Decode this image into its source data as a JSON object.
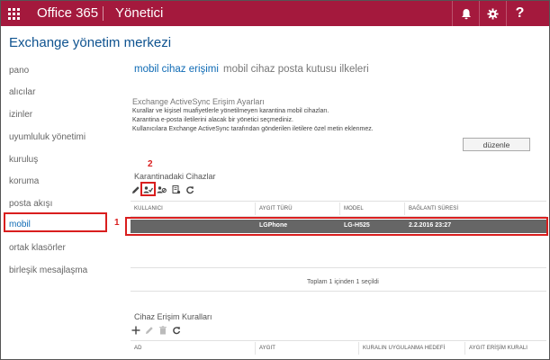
{
  "topbar": {
    "brand": "Office 365",
    "app": "Yönetici",
    "icons": [
      "waffle-icon",
      "bell-icon",
      "gear-icon",
      "help-icon"
    ],
    "help_glyph": "?",
    "color": "#a4193d"
  },
  "page": {
    "title": "Exchange yönetim merkezi"
  },
  "nav": {
    "items": [
      {
        "label": "pano"
      },
      {
        "label": "alıcılar"
      },
      {
        "label": "izinler"
      },
      {
        "label": "uyumluluk yönetimi"
      },
      {
        "label": "kuruluş"
      },
      {
        "label": "koruma"
      },
      {
        "label": "posta akışı"
      },
      {
        "label": "mobil"
      },
      {
        "label": "ortak klasörler"
      },
      {
        "label": "birleşik mesajlaşma"
      }
    ],
    "active": "mobil"
  },
  "tabs": [
    {
      "label": "mobil cihaz erişimi",
      "active": true
    },
    {
      "label": "mobil cihaz posta kutusu ilkeleri",
      "active": false
    }
  ],
  "access_settings": {
    "cutoff_heading": "Exchange ActiveSync Erişim Ayarları",
    "lines": [
      "Kurallar ve kişisel muafiyetlerle yönetilmeyen karantina mobil cihazları.",
      "Karantina e-posta iletilerini alacak bir yönetici seçmediniz.",
      "Kullanıcılara Exchange ActiveSync tarafından gönderilen iletilere özel metin eklenmez."
    ],
    "edit_label": "düzenle"
  },
  "quarantine": {
    "title": "Karantinadaki Cihazlar",
    "toolbar_icons": [
      "edit-icon",
      "allow-device-icon",
      "block-device-icon",
      "details-icon",
      "refresh-icon"
    ],
    "columns": [
      "KULLANICI",
      "AYGIT TÜRÜ",
      "MODEL",
      "BAĞLANTI SÜRESİ"
    ],
    "rows": [
      {
        "user": "",
        "device_type": "LGPhone",
        "model": "LG-H525",
        "connected": "2.2.2016 23:27"
      }
    ],
    "footer": "Toplam 1 içinden 1 seçildi"
  },
  "access_rules": {
    "title": "Cihaz Erişim Kuralları",
    "toolbar_icons": [
      "add-icon",
      "edit-icon",
      "delete-icon",
      "refresh-icon"
    ],
    "columns": [
      "AD",
      "AYGIT",
      "KURALIN UYGULANMA HEDEFİ",
      "AYGIT ERİŞİM KURALI"
    ]
  },
  "annotations": {
    "callout_1": "1",
    "callout_2": "2",
    "color": "#d91e1e"
  }
}
